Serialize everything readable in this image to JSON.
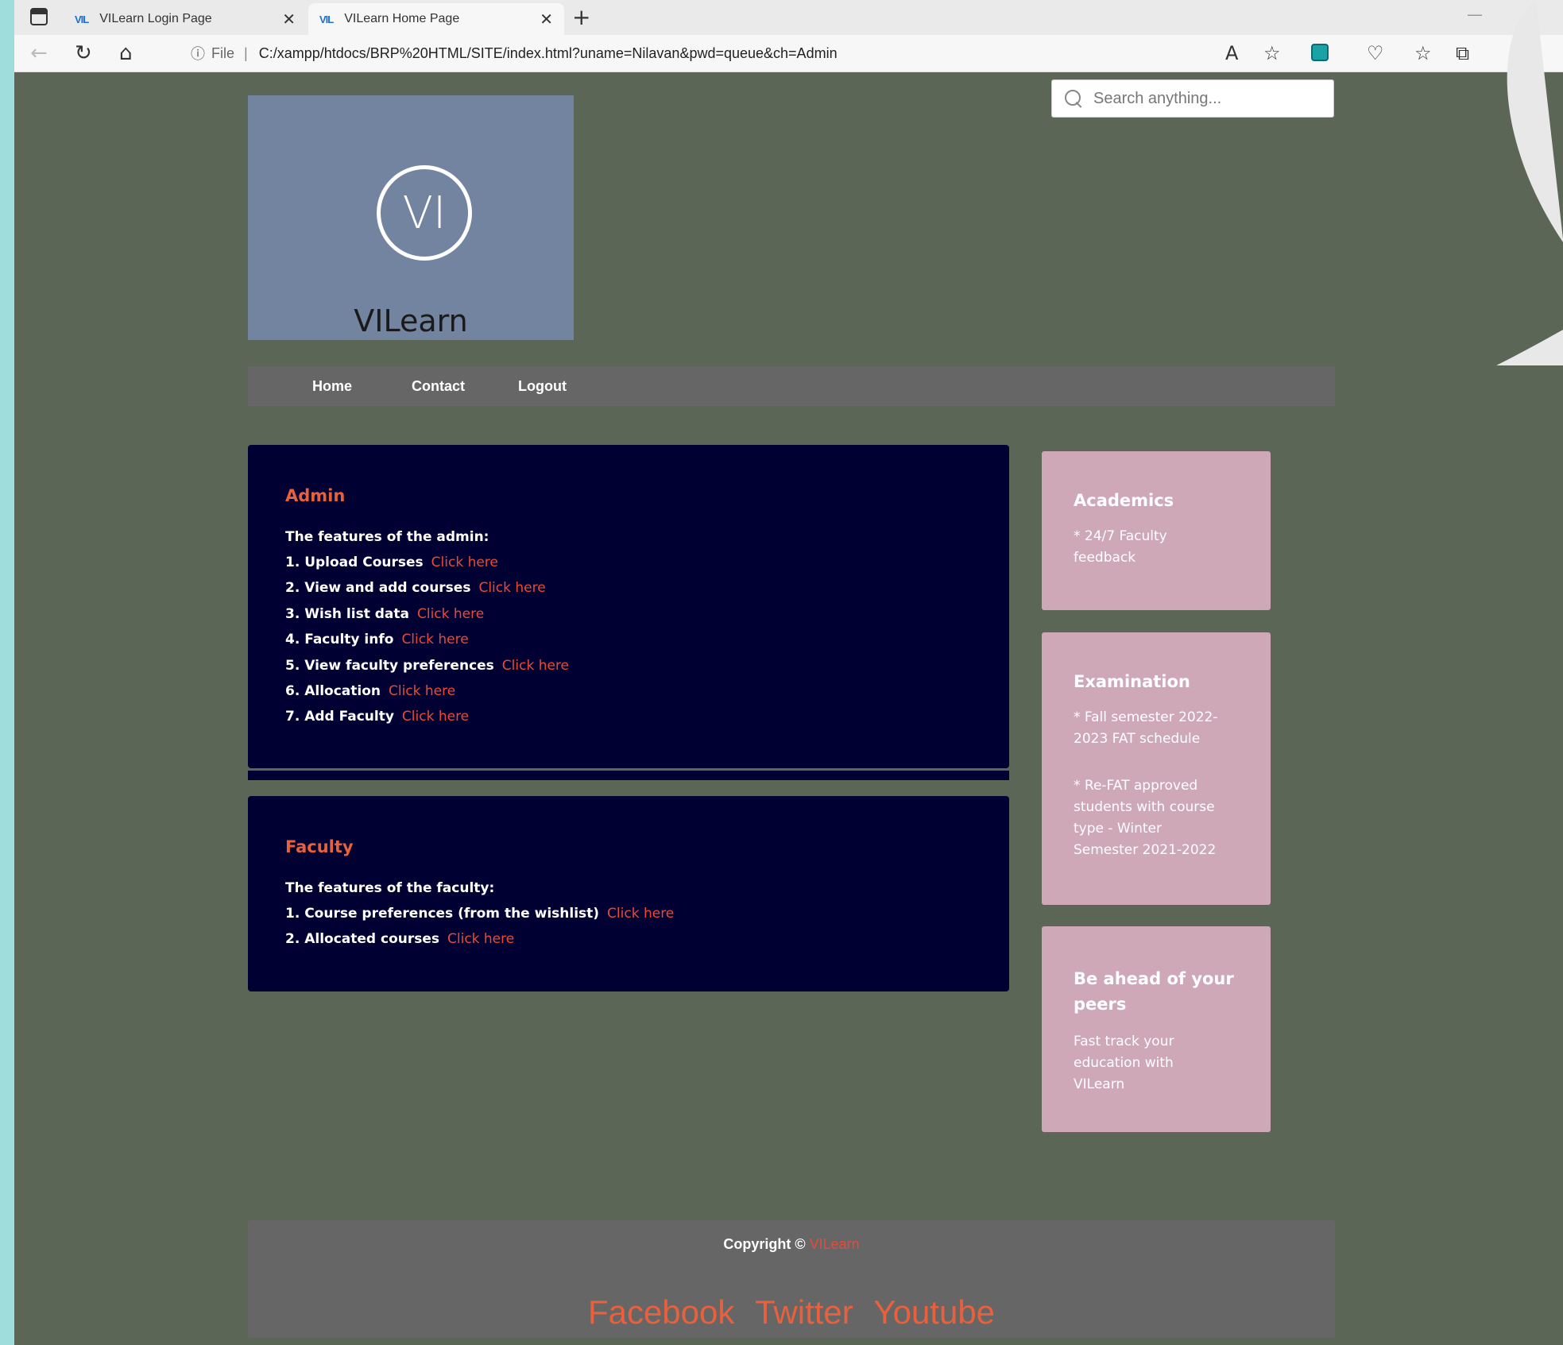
{
  "browser": {
    "tabs": [
      {
        "favicon": "VIL",
        "title": "VILearn Login Page",
        "close": "✕"
      },
      {
        "favicon": "VIL",
        "title": "VILearn Home Page",
        "close": "✕"
      }
    ],
    "new_tab": "+",
    "url_file_label": "File",
    "url": "C:/xampp/htdocs/BRP%20HTML/SITE/index.html?uname=Nilavan&pwd=queue&ch=Admin"
  },
  "site": {
    "logo_mark": "VI",
    "logo_text": "VILearn"
  },
  "search": {
    "placeholder": "Search anything..."
  },
  "menu": {
    "items": [
      "Home",
      "Contact",
      "Logout"
    ]
  },
  "admin_panel": {
    "heading": "Admin",
    "intro": "The features of the admin:",
    "link_text": "Click here",
    "items": [
      "1. Upload Courses",
      "2. View and add courses",
      "3. Wish list data",
      "4. Faculty info",
      "5. View faculty preferences",
      "6. Allocation",
      "7. Add Faculty"
    ]
  },
  "faculty_panel": {
    "heading": "Faculty",
    "intro": "The features of the faculty:",
    "link_text": "Click here",
    "items": [
      "1. Course preferences (from the wishlist)",
      "2. Allocated courses"
    ]
  },
  "sidebar": {
    "academics": {
      "title": "Academics",
      "lines": [
        "* 24/7 Faculty",
        "feedback"
      ]
    },
    "examination": {
      "title": "Examination",
      "item1": [
        "* Fall semester 2022-",
        "2023 FAT schedule"
      ],
      "item2": [
        "* Re-FAT approved",
        "students with course",
        "type - Winter",
        "Semester 2021-2022"
      ]
    },
    "ahead": {
      "title_lines": [
        "Be ahead of your",
        "peers"
      ],
      "lines": [
        "Fast track your",
        "education with",
        "VILearn"
      ]
    }
  },
  "footer": {
    "copyright": "Copyright ©",
    "brand": "VILearn",
    "social": [
      "Facebook",
      "Twitter",
      "Youtube"
    ]
  },
  "colors": {
    "page_bg": "#5b6656",
    "panel_bg": "#000033",
    "accent": "#e8603c",
    "card_bg": "#cfa8b8",
    "logo_bg": "#7284a0",
    "menu_bg": "#666666"
  }
}
